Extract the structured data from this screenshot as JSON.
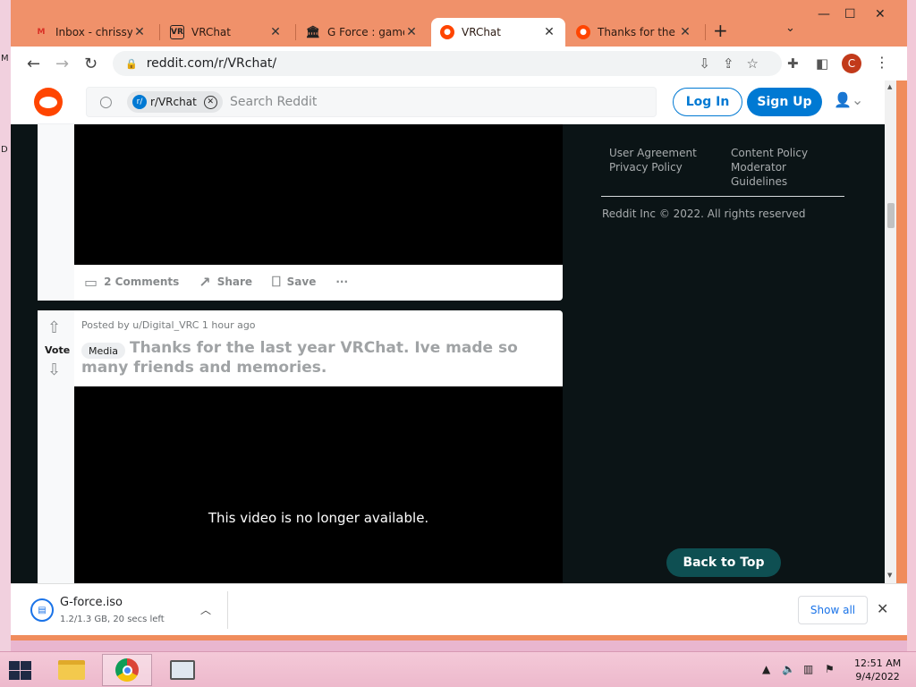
{
  "desktop": {
    "left_marks": [
      "M",
      "D"
    ]
  },
  "browser": {
    "tabs": [
      {
        "title": "Inbox - chrissym",
        "icon": "gmail-icon"
      },
      {
        "title": "VRChat",
        "icon": "vrchat-icon"
      },
      {
        "title": "G Force : gameh",
        "icon": "archive-icon"
      },
      {
        "title": "VRChat",
        "icon": "reddit-icon",
        "active": true
      },
      {
        "title": "Thanks for the la",
        "icon": "reddit-icon"
      }
    ],
    "new_tab": "+",
    "url": "reddit.com/r/VRchat/",
    "profile_initial": "C"
  },
  "reddit": {
    "search_chip": "r/VRchat",
    "search_placeholder": "Search Reddit",
    "login": "Log In",
    "signup": "Sign Up",
    "posts": [
      {
        "actions": {
          "comments": "2 Comments",
          "share": "Share",
          "save": "Save",
          "more": "···"
        }
      },
      {
        "vote_label": "Vote",
        "meta": "Posted by u/Digital_VRC 1 hour ago",
        "flair": "Media",
        "title": "Thanks for the last year VRChat. Ive made so many friends and memories.",
        "video_message": "This video is no longer available."
      }
    ],
    "sidebar": {
      "links_left": [
        "User Agreement",
        "Privacy Policy"
      ],
      "links_right": [
        "Content Policy",
        "Moderator",
        "Guidelines"
      ],
      "copyright": "Reddit Inc © 2022. All rights reserved",
      "back_to_top": "Back to Top"
    }
  },
  "downloads": {
    "filename": "G-force.iso",
    "status": "1.2/1.3 GB, 20 secs left",
    "show_all": "Show all"
  },
  "taskbar": {
    "time": "12:51 AM",
    "date": "9/4/2022"
  },
  "colors": {
    "accent": "#f08c5c",
    "reddit_orange": "#ff4500",
    "reddit_blue": "#0079d3",
    "back_to_top": "#0e4f52"
  }
}
